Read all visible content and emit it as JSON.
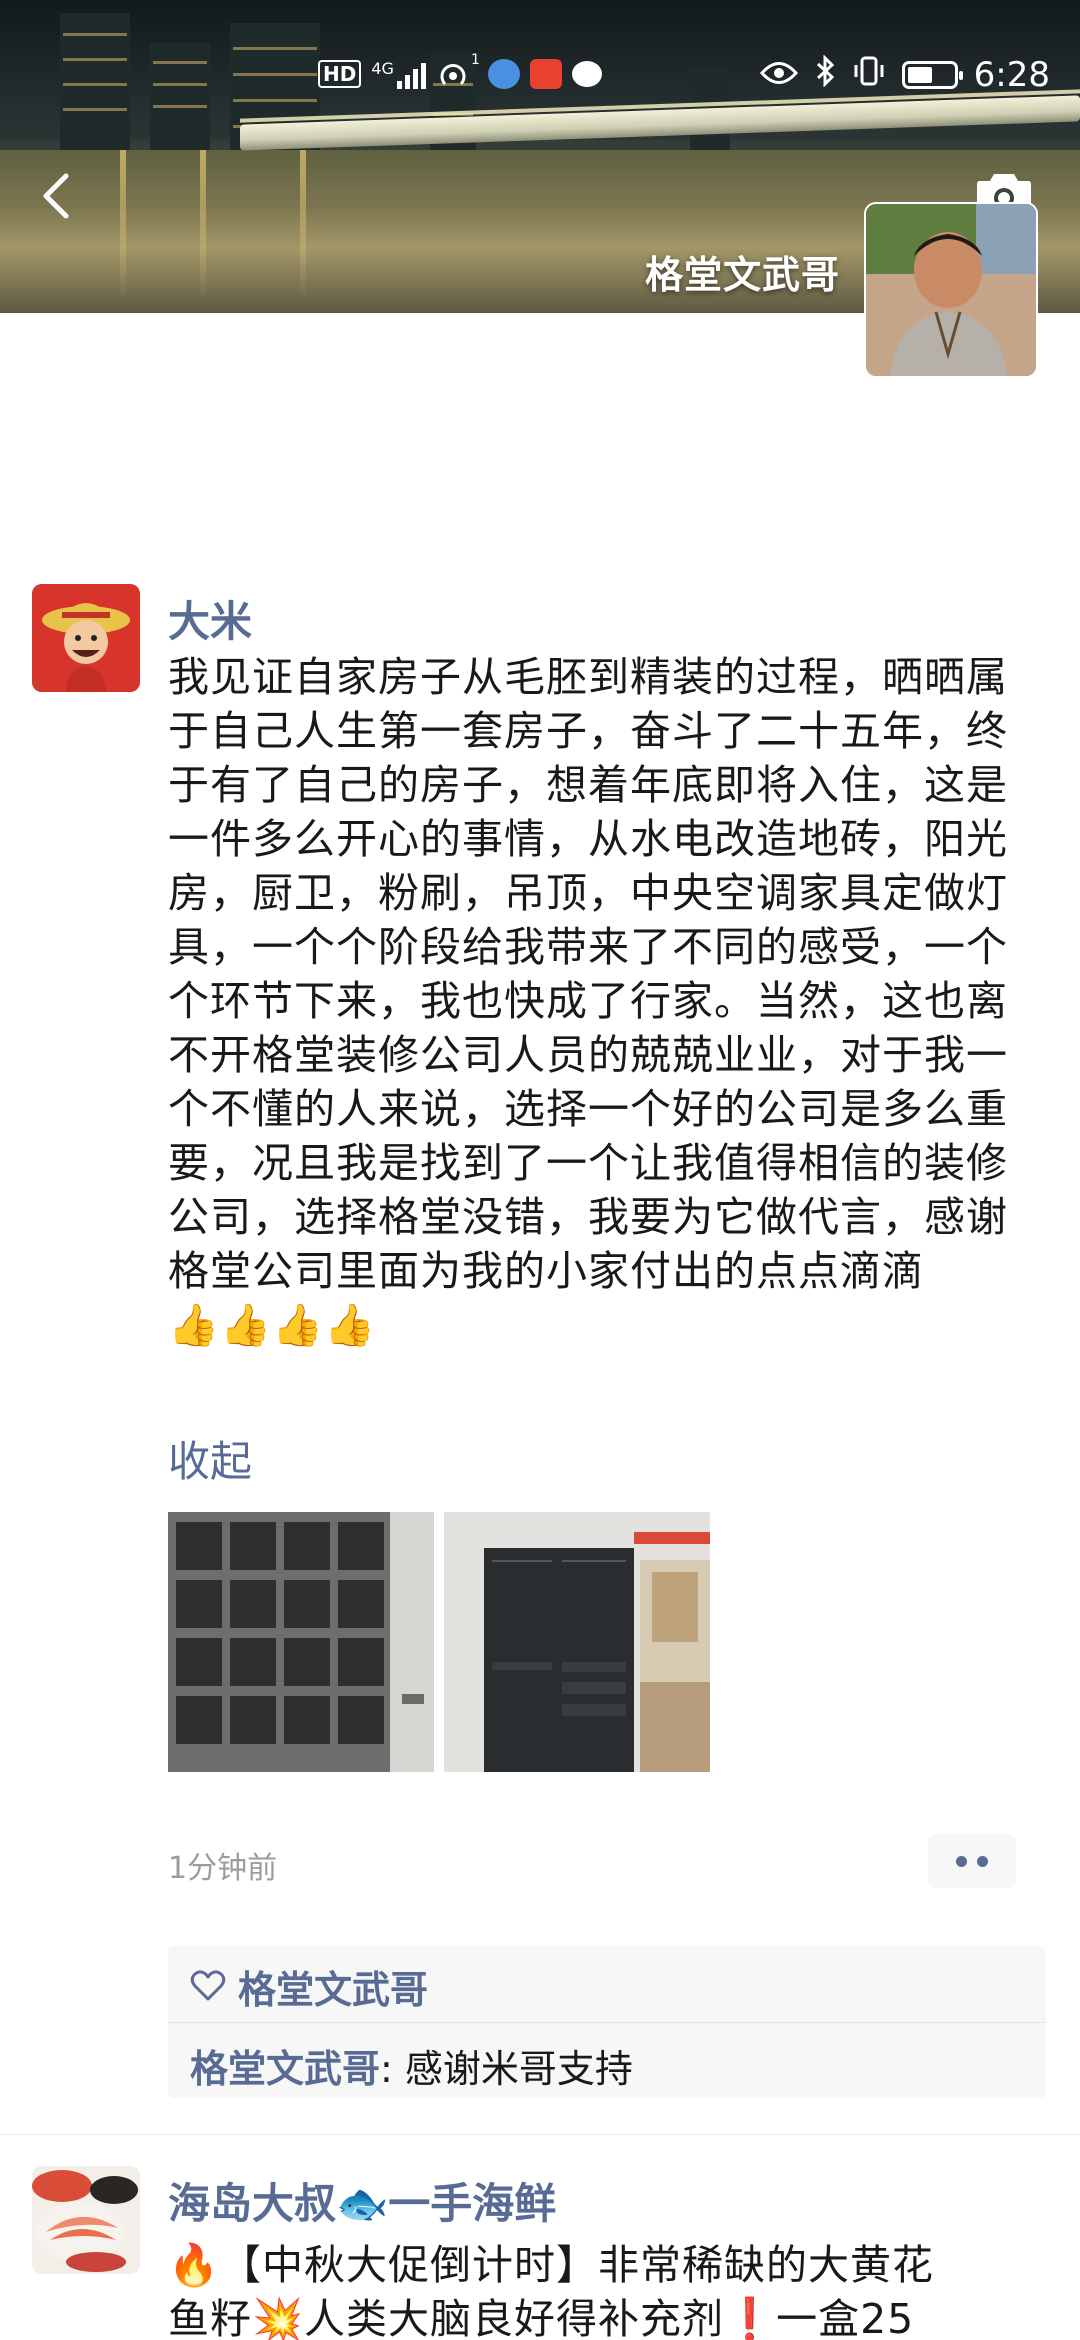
{
  "status_bar": {
    "left_icons": [
      "hd-icon",
      "4g-signal-icon",
      "hotspot-icon",
      "app-notification-icon",
      "app-notification-icon",
      "message-icon"
    ],
    "network": "4G",
    "hotspot_count": "1",
    "time": "6:28"
  },
  "header": {
    "owner_name": "格堂文武哥",
    "back_icon": "chevron-left-icon",
    "camera_icon": "camera-icon"
  },
  "post": {
    "author": "大米",
    "text": "我见证自家房子从毛胚到精装的过程，晒晒属于自己人生第一套房子，奋斗了二十五年，终于有了自己的房子，想着年底即将入住，这是一件多么开心的事情，从水电改造地砖，阳光房，厨卫，粉刷，吊顶，中央空调家具定做灯具，一个个阶段给我带来了不同的感受，一个个环节下来，我也快成了行家。当然，这也离不开格堂装修公司人员的兢兢业业，对于我一个不懂的人来说，选择一个好的公司是多么重要，况且我是找到了一个让我值得相信的装修公司，选择格堂没错，我要为它做代言，感谢格堂公司里面为我的小家付出的点点滴滴",
    "emoji": "👍👍👍👍",
    "collapse_label": "收起",
    "timestamp": "1分钟前",
    "likes": [
      "格堂文武哥"
    ],
    "comment": {
      "author": "格堂文武哥",
      "separator": ": ",
      "text": "感谢米哥支持"
    }
  },
  "next_post": {
    "author": "海岛大叔🐟一手海鲜",
    "text_line1": "🔥【中秋大促倒计时】非常稀缺的大黄花",
    "text_line2": "鱼籽💥人类大脑良好得补充剂❗一盒25"
  }
}
